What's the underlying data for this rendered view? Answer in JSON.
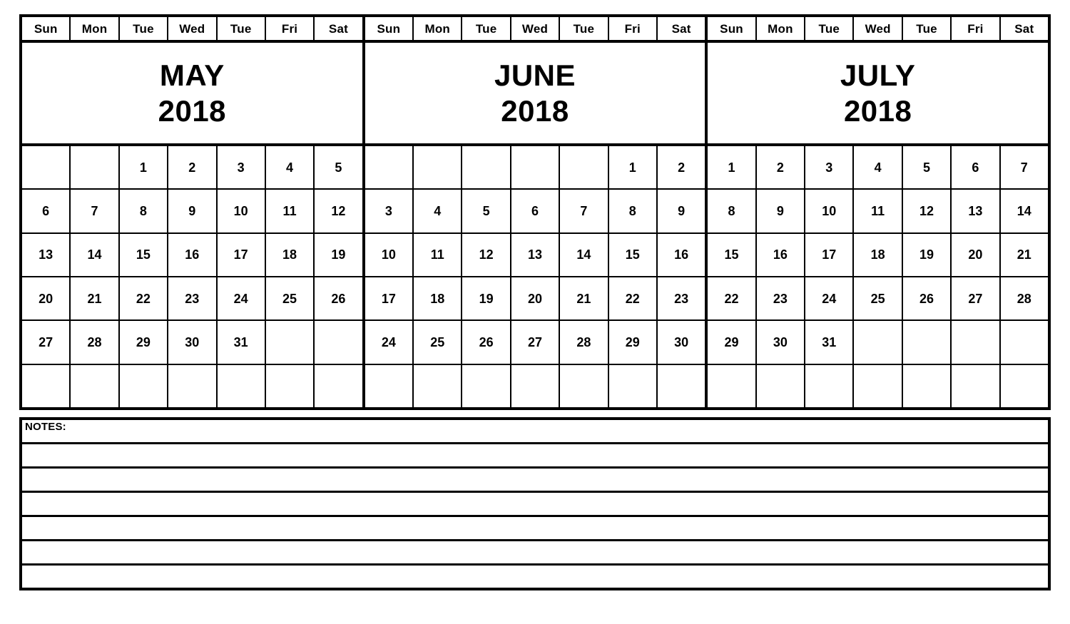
{
  "document": {
    "type": "three-month-calendar",
    "year": "2018"
  },
  "day_headers": [
    "Sun",
    "Mon",
    "Tue",
    "Wed",
    "Tue",
    "Fri",
    "Sat"
  ],
  "months": [
    {
      "name": "MAY",
      "year": "2018",
      "weeks": [
        [
          "",
          "",
          "1",
          "2",
          "3",
          "4",
          "5"
        ],
        [
          "6",
          "7",
          "8",
          "9",
          "10",
          "11",
          "12"
        ],
        [
          "13",
          "14",
          "15",
          "16",
          "17",
          "18",
          "19"
        ],
        [
          "20",
          "21",
          "22",
          "23",
          "24",
          "25",
          "26"
        ],
        [
          "27",
          "28",
          "29",
          "30",
          "31",
          "",
          ""
        ],
        [
          "",
          "",
          "",
          "",
          "",
          "",
          ""
        ]
      ]
    },
    {
      "name": "JUNE",
      "year": "2018",
      "weeks": [
        [
          "",
          "",
          "",
          "",
          "",
          "1",
          "2"
        ],
        [
          "3",
          "4",
          "5",
          "6",
          "7",
          "8",
          "9"
        ],
        [
          "10",
          "11",
          "12",
          "13",
          "14",
          "15",
          "16"
        ],
        [
          "17",
          "18",
          "19",
          "20",
          "21",
          "22",
          "23"
        ],
        [
          "24",
          "25",
          "26",
          "27",
          "28",
          "29",
          "30"
        ],
        [
          "",
          "",
          "",
          "",
          "",
          "",
          ""
        ]
      ]
    },
    {
      "name": "JULY",
      "year": "2018",
      "weeks": [
        [
          "1",
          "2",
          "3",
          "4",
          "5",
          "6",
          "7"
        ],
        [
          "8",
          "9",
          "10",
          "11",
          "12",
          "13",
          "14"
        ],
        [
          "15",
          "16",
          "17",
          "18",
          "19",
          "20",
          "21"
        ],
        [
          "22",
          "23",
          "24",
          "25",
          "26",
          "27",
          "28"
        ],
        [
          "29",
          "30",
          "31",
          "",
          "",
          "",
          ""
        ],
        [
          "",
          "",
          "",
          "",
          "",
          "",
          ""
        ]
      ]
    }
  ],
  "notes": {
    "label": "NOTES:",
    "blank_line_count": 6
  },
  "colors": {
    "ink": "#000000",
    "paper": "#ffffff"
  }
}
